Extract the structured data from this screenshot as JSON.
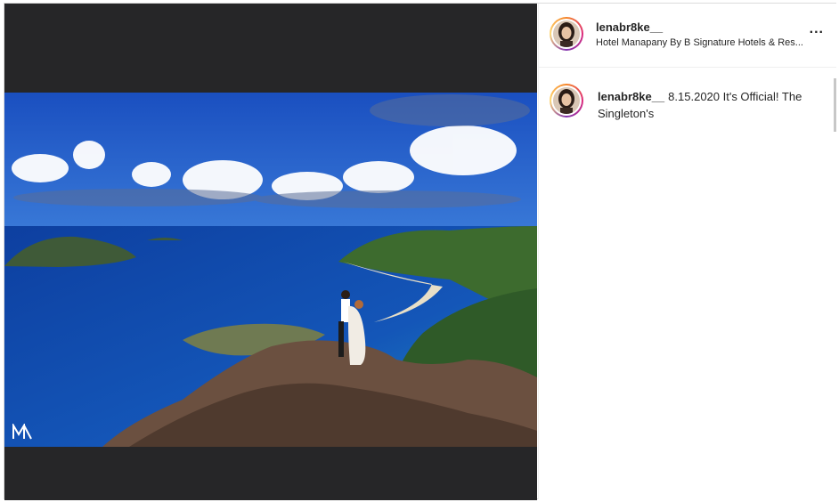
{
  "post": {
    "username": "lenabr8ke__",
    "location": "Hotel Manapany By B Signature Hotels & Res...",
    "more_icon": "more-options-icon",
    "more_label": "..."
  },
  "comment": {
    "username": "lenabr8ke__",
    "text": "8.15.2020 It's Official! The Singleton's"
  },
  "photo": {
    "watermark": "M"
  },
  "colors": {
    "media_background": "#262628",
    "sea": "#123a8a",
    "border": "#dbdbdb"
  }
}
